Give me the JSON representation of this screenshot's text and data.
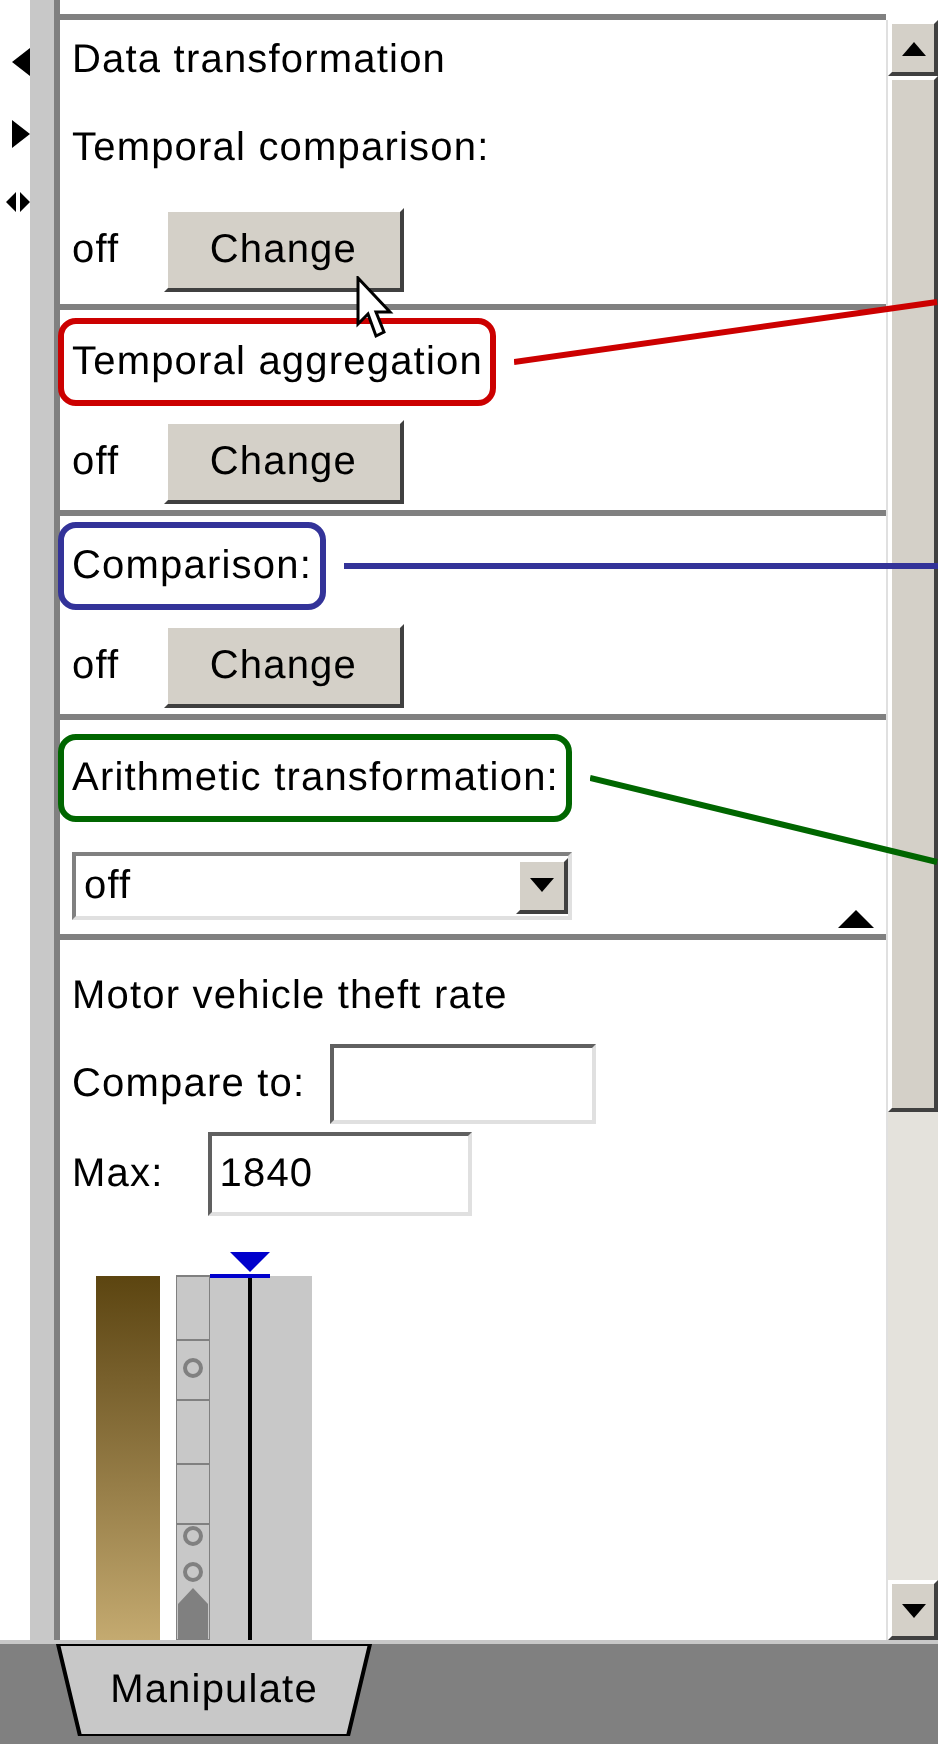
{
  "panel_title": "Data transformation",
  "transforms": [
    {
      "kind": "button",
      "label": "Temporal comparison:",
      "value": "off",
      "button": "Change"
    },
    {
      "kind": "button",
      "label": "Temporal aggregation",
      "value": "off",
      "button": "Change",
      "color": "#cc0000"
    },
    {
      "kind": "button",
      "label": "Comparison:",
      "value": "off",
      "button": "Change",
      "color": "#333399"
    },
    {
      "kind": "dropdown",
      "label": "Arithmetic transformation:",
      "value": "off",
      "color": "#006600"
    }
  ],
  "variable": {
    "title": "Motor vehicle theft rate",
    "compare_label": "Compare to:",
    "max_label": "Max:",
    "max_value": "1840"
  },
  "tabs": [
    {
      "label": "Manipulate",
      "selected": true
    }
  ]
}
